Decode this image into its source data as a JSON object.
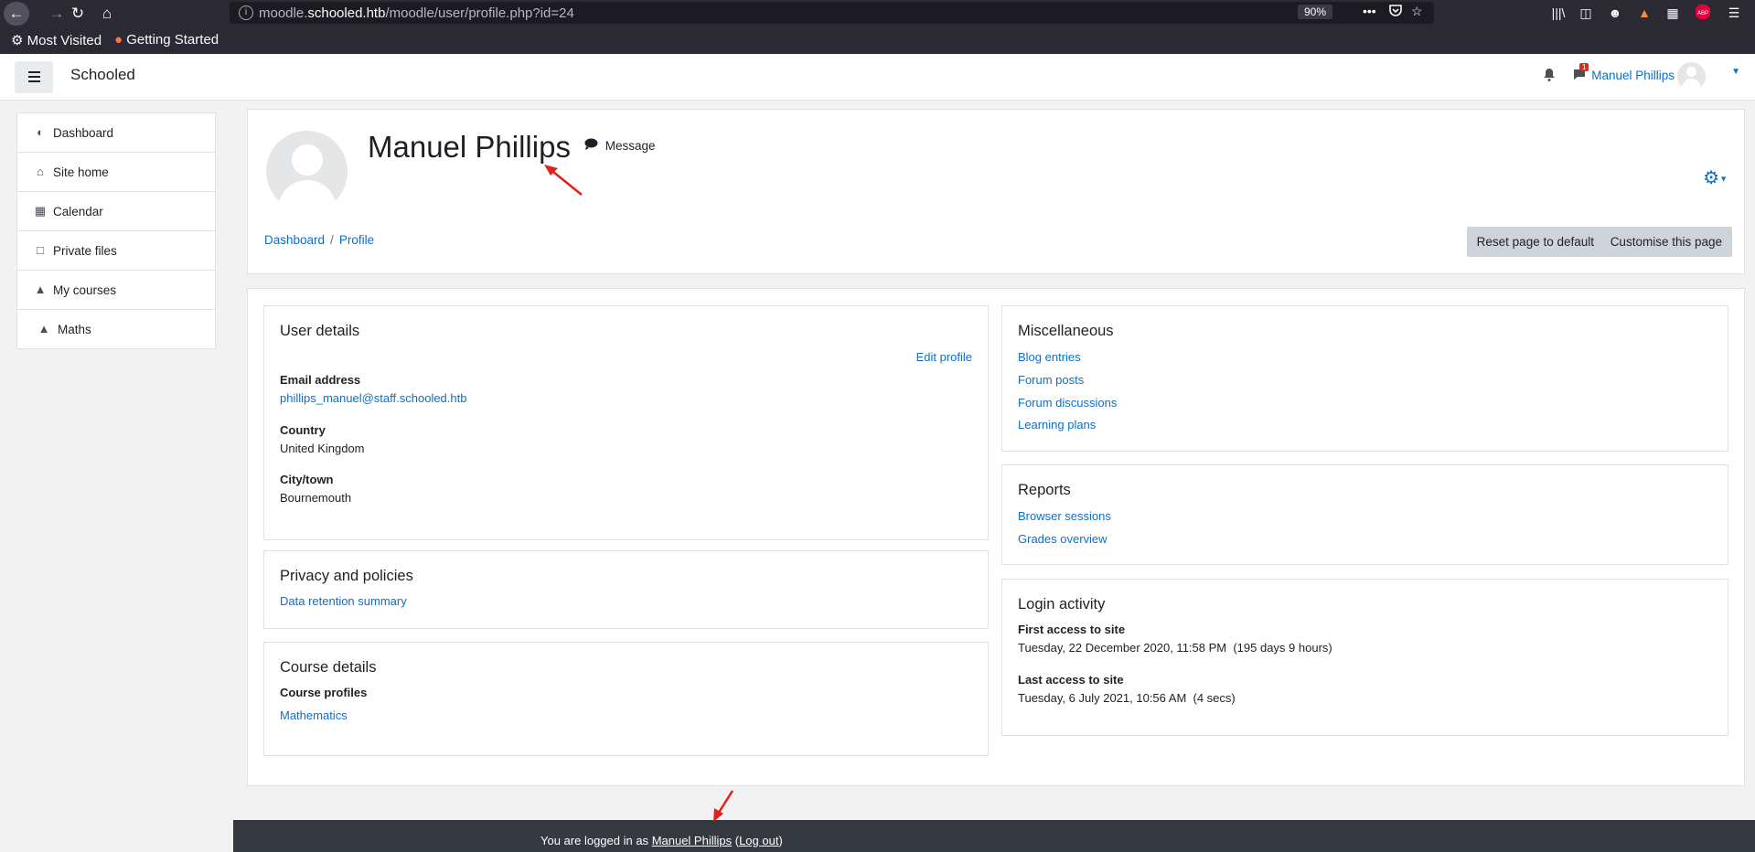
{
  "browser": {
    "url_prefix": "moodle.",
    "url_host": "schooled.htb",
    "url_path": "/moodle/user/profile.php?id=24",
    "zoom": "90%",
    "bookmarks": [
      "Most Visited",
      "Getting Started"
    ]
  },
  "navbar": {
    "brand": "Schooled",
    "user_name": "Manuel Phillips",
    "message_badge": "1"
  },
  "sidebar": {
    "items": [
      {
        "label": "Dashboard",
        "icon": "dashboard-icon"
      },
      {
        "label": "Site home",
        "icon": "home-icon"
      },
      {
        "label": "Calendar",
        "icon": "calendar-icon"
      },
      {
        "label": "Private files",
        "icon": "file-icon"
      },
      {
        "label": "My courses",
        "icon": "graduation-cap-icon"
      },
      {
        "label": "Maths",
        "icon": "graduation-cap-icon"
      }
    ]
  },
  "header": {
    "name": "Manuel Phillips",
    "message_label": "Message",
    "breadcrumb": [
      "Dashboard",
      "Profile"
    ],
    "reset_label": "Reset page to default",
    "customise_label": "Customise this page"
  },
  "user_details": {
    "title": "User details",
    "edit_label": "Edit profile",
    "email_label": "Email address",
    "email": "phillips_manuel@staff.schooled.htb",
    "country_label": "Country",
    "country": "United Kingdom",
    "city_label": "City/town",
    "city": "Bournemouth"
  },
  "privacy": {
    "title": "Privacy and policies",
    "link": "Data retention summary"
  },
  "course_details": {
    "title": "Course details",
    "profiles_label": "Course profiles",
    "course": "Mathematics"
  },
  "misc": {
    "title": "Miscellaneous",
    "links": [
      "Blog entries",
      "Forum posts",
      "Forum discussions",
      "Learning plans"
    ]
  },
  "reports": {
    "title": "Reports",
    "links": [
      "Browser sessions",
      "Grades overview"
    ]
  },
  "login_activity": {
    "title": "Login activity",
    "first_label": "First access to site",
    "first_value": "Tuesday, 22 December 2020, 11:58 PM  (195 days 9 hours)",
    "last_label": "Last access to site",
    "last_value": "Tuesday, 6 July 2021, 10:56 AM  (4 secs)"
  },
  "footer": {
    "prefix": "You are logged in as",
    "user": "Manuel Phillips",
    "logout": "Log out"
  },
  "colors": {
    "link": "#0f6fc5",
    "annotation_arrow": "#e0201b",
    "footer_bg": "#343a40"
  }
}
